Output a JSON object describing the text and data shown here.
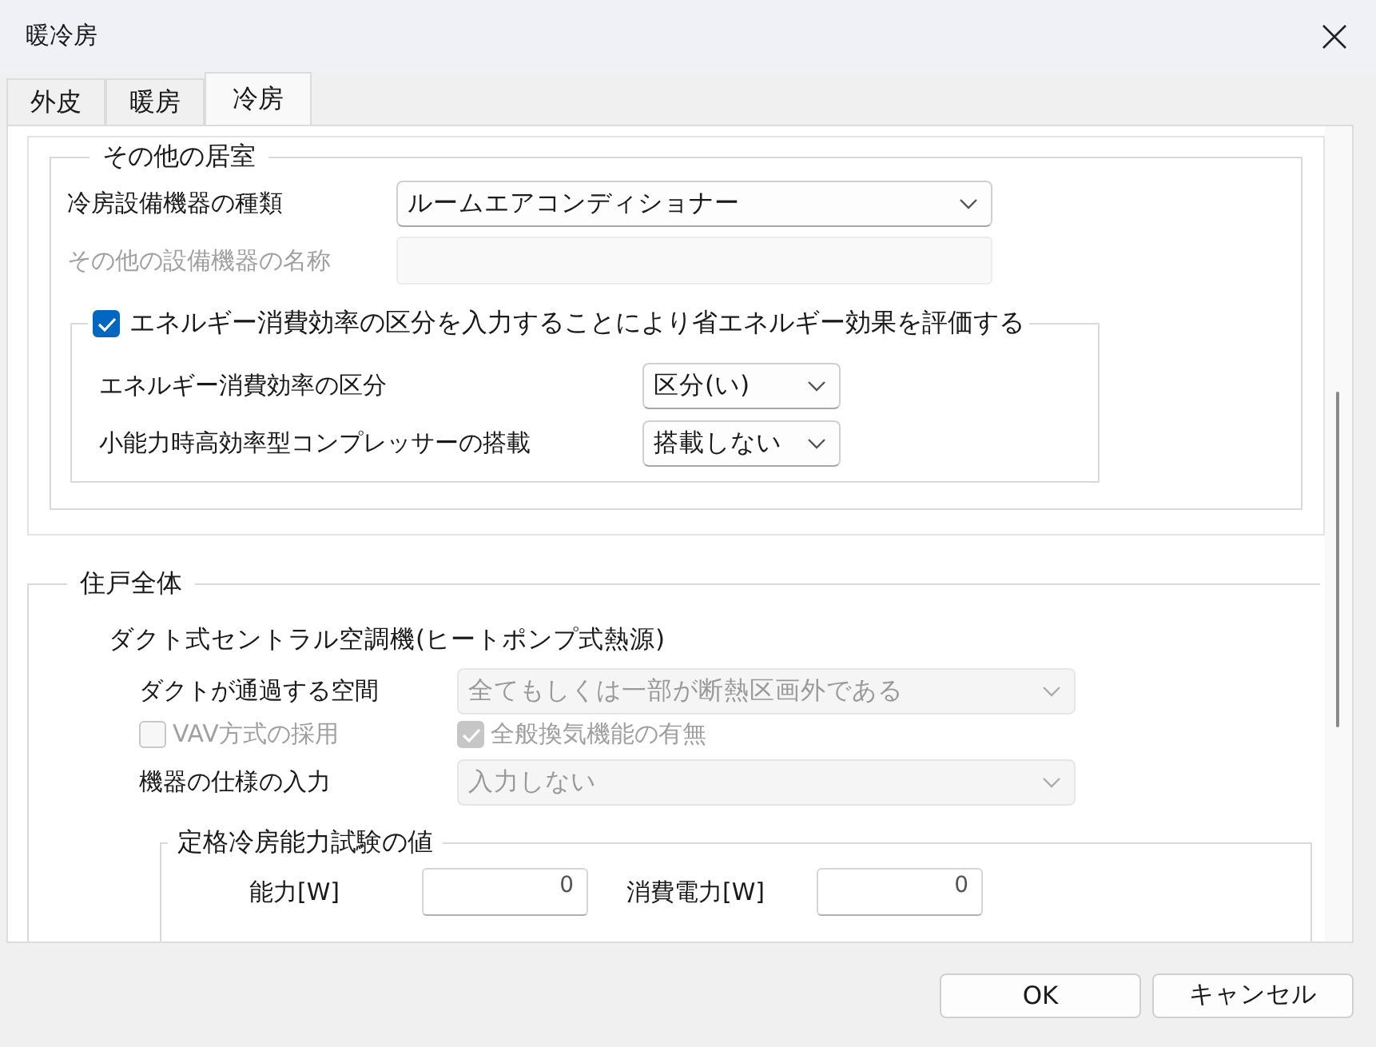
{
  "window": {
    "title": "暖冷房"
  },
  "tabs": [
    {
      "label": "外皮",
      "selected": false
    },
    {
      "label": "暖房",
      "selected": false
    },
    {
      "label": "冷房",
      "selected": true
    }
  ],
  "other_rooms": {
    "title": "その他の居室",
    "fields": [
      {
        "kind": "select",
        "label": "冷房設備機器の種類",
        "value": "ルームエアコンディショナー",
        "disabled": false
      },
      {
        "kind": "input",
        "label": "その他の設備機器の名称",
        "disabled": true
      }
    ],
    "efficiency": {
      "label": "エネルギー消費効率の区分を入力することにより省エネルギー効果を評価する",
      "checked": true,
      "fields": [
        {
          "kind": "select",
          "label": "エネルギー消費効率の区分",
          "value": "区分(い)",
          "disabled": false
        },
        {
          "kind": "select",
          "label": "小能力時高効率型コンプレッサーの搭載",
          "value": "搭載しない",
          "disabled": false
        }
      ]
    }
  },
  "whole_dwelling": {
    "title": "住戸全体",
    "subtitle": "ダクト式セントラル空調機(ヒートポンプ式熱源)",
    "rows": [
      {
        "kind": "select",
        "label": "ダクトが通過する空間",
        "value": "全てもしくは一部が断熱区画外である",
        "disabled": true
      },
      {
        "kind": "checks",
        "items": [
          {
            "label": "VAV方式の採用",
            "checked": false,
            "disabled": true
          },
          {
            "label": "全般換気機能の有無",
            "checked": true,
            "disabled": true
          }
        ]
      },
      {
        "kind": "select",
        "label": "機器の仕様の入力",
        "value": "入力しない",
        "disabled": true
      }
    ],
    "rating": {
      "title": "定格冷房能力試験の値",
      "fields": [
        {
          "label": "能力[W]",
          "value": "0"
        },
        {
          "label": "消費電力[W]",
          "value": "0"
        }
      ]
    }
  },
  "buttons": [
    {
      "label": "OK"
    },
    {
      "label": "キャンセル"
    }
  ]
}
